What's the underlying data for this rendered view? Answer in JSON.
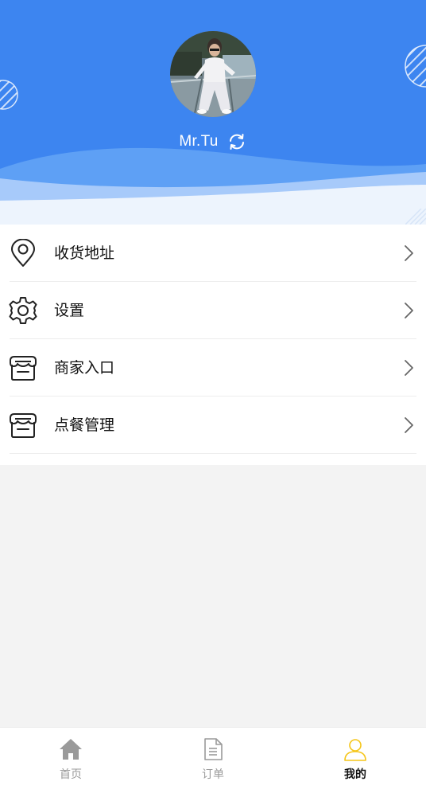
{
  "profile": {
    "name": "Mr.Tu",
    "avatar_icon": "user-photo",
    "switch_icon": "refresh-icon",
    "header_color": "#3d85f0"
  },
  "menu": {
    "items": [
      {
        "label": "收货地址",
        "icon": "location-pin-icon"
      },
      {
        "label": "设置",
        "icon": "gear-icon"
      },
      {
        "label": "商家入口",
        "icon": "store-icon"
      },
      {
        "label": "点餐管理",
        "icon": "store-icon"
      }
    ]
  },
  "tabbar": {
    "tabs": [
      {
        "label": "首页",
        "icon": "home-icon",
        "active": false
      },
      {
        "label": "订单",
        "icon": "document-icon",
        "active": false
      },
      {
        "label": "我的",
        "icon": "person-icon",
        "active": true
      }
    ],
    "active_color": "#f5c518",
    "inactive_color": "#9a9a9a"
  }
}
